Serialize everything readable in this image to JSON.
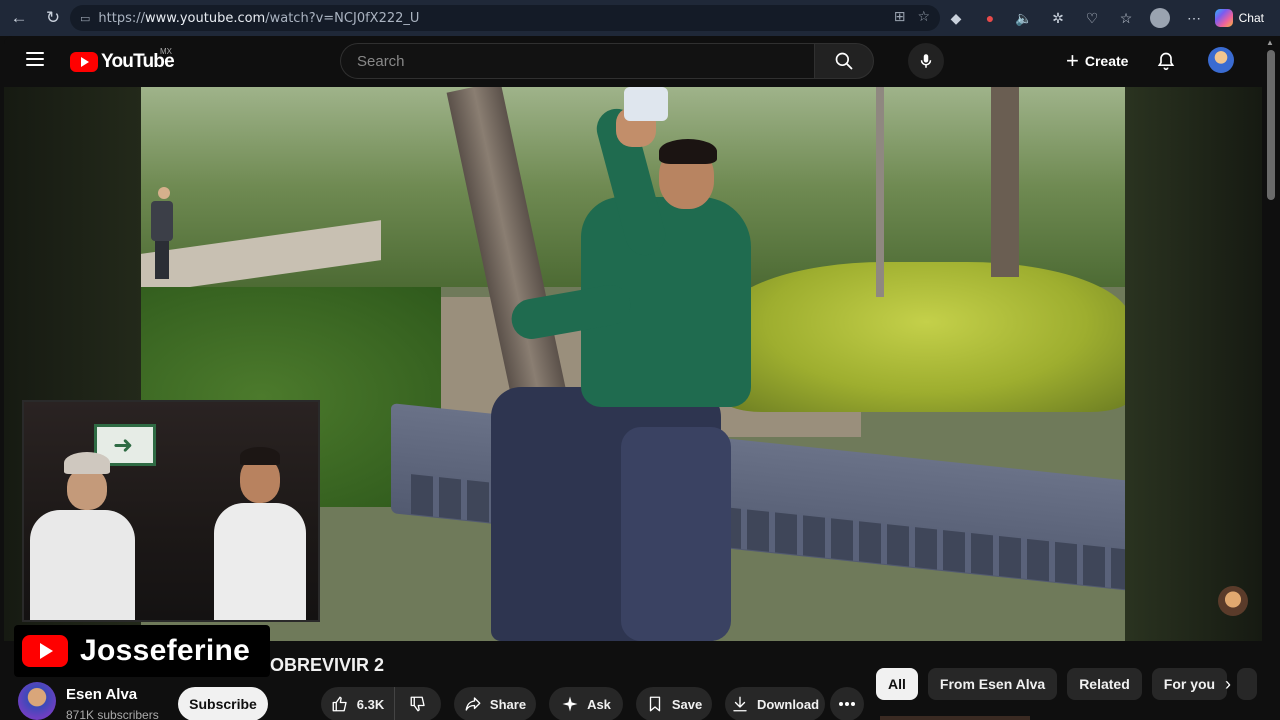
{
  "browser": {
    "url_prefix": "https://",
    "url_domain": "www.youtube.com",
    "url_path": "/watch?v=NCJ0fX222_U",
    "chat_label": "Chat"
  },
  "masthead": {
    "logo_text": "YouTube",
    "country_code": "MX",
    "search_placeholder": "Search",
    "create_label": "Create"
  },
  "video": {
    "title_visible": "OBREVIVIR 2",
    "watermark_text": "Josseferine"
  },
  "channel": {
    "name": "Esen Alva",
    "subscribers": "871K subscribers",
    "subscribe_label": "Subscribe"
  },
  "actions": {
    "likes": "6.3K",
    "share": "Share",
    "ask": "Ask",
    "save": "Save",
    "download": "Download"
  },
  "chips": [
    "All",
    "From Esen Alva",
    "Related",
    "For you"
  ],
  "icons": {
    "back": "back-arrow-icon",
    "reload": "reload-icon",
    "menu": "hamburger-menu-icon",
    "search": "search-icon",
    "mic": "microphone-icon",
    "bell": "notification-bell-icon",
    "like": "thumbs-up-icon",
    "dislike": "thumbs-down-icon",
    "share": "share-arrow-icon",
    "ask": "sparkle-icon",
    "save": "bookmark-icon",
    "download": "download-icon",
    "more": "more-dots-icon"
  },
  "colors": {
    "brand_red": "#ff0000",
    "page_bg": "#0f0f0f",
    "button_bg": "#272727",
    "browser_bar": "#1f2838"
  }
}
